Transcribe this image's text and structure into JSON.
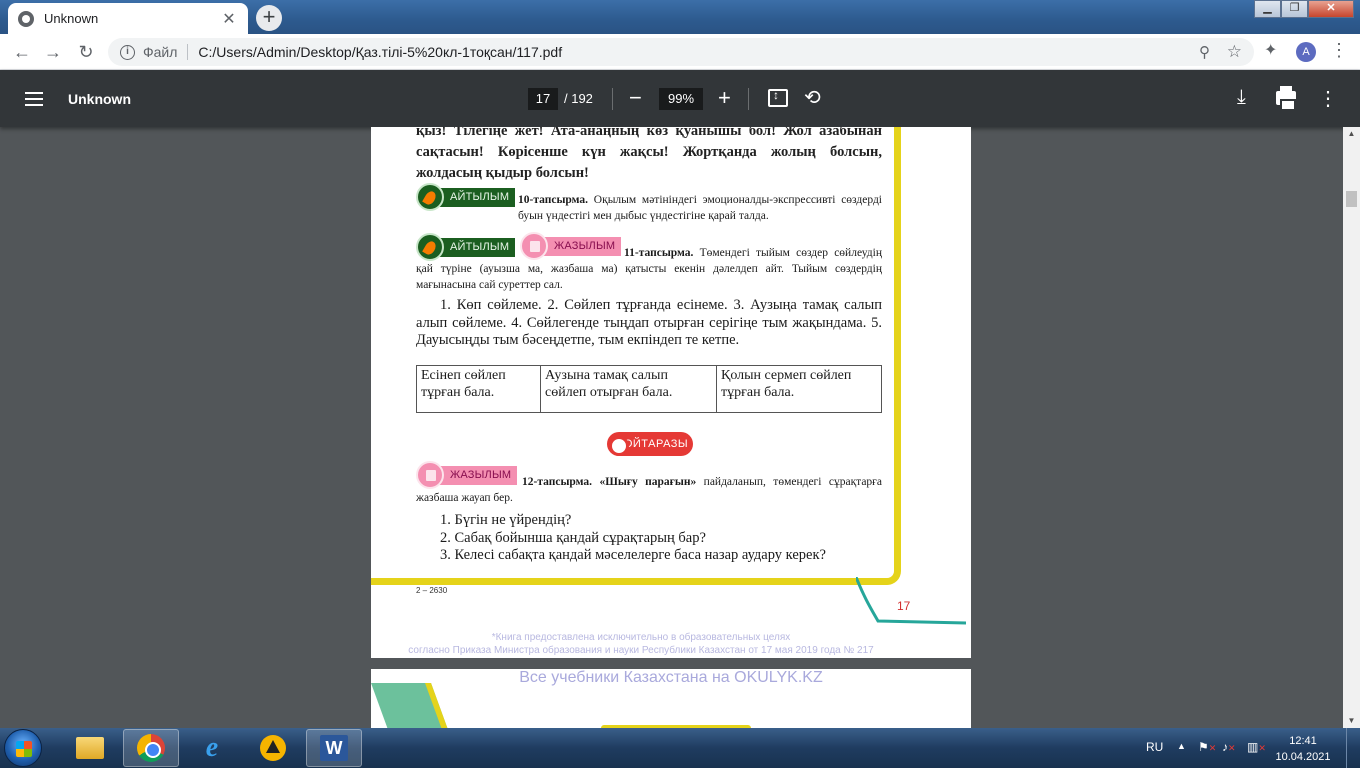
{
  "browser": {
    "tab_title": "Unknown",
    "tab_close": "✕",
    "new_tab": "+",
    "window_controls": {
      "minimize": "▁",
      "maximize": "❐",
      "close": "✕"
    },
    "address": {
      "scheme_label": "Файл",
      "url": "C:/Users/Admin/Desktop/Қаз.тілі-5%20кл-1тоқсан/117.pdf"
    },
    "nav": {
      "back": "←",
      "forward": "→",
      "reload": "↻",
      "zoom": "⚲",
      "star": "☆",
      "extensions": "✦",
      "menu": "⋮"
    },
    "profile_initial": "A"
  },
  "pdf_viewer": {
    "title": "Unknown",
    "current_page": "17",
    "total_pages": "/ 192",
    "zoom": "99%",
    "zoom_minus": "−",
    "zoom_plus": "+",
    "rotate": "⟲",
    "download": "⤓",
    "more": "⋮"
  },
  "page": {
    "intro": "қыз! Тілегіңе жет! Ата-анаңның көз қуанышы бол! Жол азабынан сақтасын! Көрісенше күн жақсы! Жортқанда жолың болсын, жолдасың қыдыр болсын!",
    "badge_speaking": "АЙТЫЛЫМ",
    "badge_writing": "ЖАЗЫЛЫМ",
    "task10_label": "10-тапсырма.",
    "task10_text": "Оқылым мәтініндегі эмоционалды-экспрессивті сөздерді буын үндестігі мен дыбыс үндестігіне қарай талда.",
    "task11_label": "11-тапсырма.",
    "task11_text": "Төмендегі тыйым сөздер сөйлеудің қай түріне (ауызша ма, жазбаша ма) қатысты екенін дәлелдеп айт. Тыйым сөздердің мағынасына сай суреттер сал.",
    "list11": "1. Көп сөйлеме. 2. Сөйлеп тұрғанда есінеме. 3. Аузыңа тамақ салып алып сөйлеме. 4. Сөйлегенде тыңдап отырған серігіңе тым жақындама. 5. Дауысыңды тым бәсеңдетпе, тым екпіндеп те кетпе.",
    "table": [
      "Есінеп сөйлеп тұрған бала.",
      "Аузына тамақ салып сөйлеп отырған бала.",
      "Қолын сермеп сөйлеп тұрған бала."
    ],
    "reflection": "ОЙТАРАЗЫ",
    "task12_label": "12-тапсырма.",
    "task12_quote": "«Шығу парағын»",
    "task12_text": "пайдаланып, төмендегі сұрақтарға жазбаша жауап бер.",
    "questions": [
      "1. Бүгін не үйрендің?",
      "2. Сабақ бойынша қандай сұрақтарың бар?",
      "3. Келесі сабақта қандай мәселелерге баса назар аудару керек?"
    ],
    "print_code": "2 – 2630",
    "page_number": "17",
    "disclaimer_1": "*Книга предоставлена исключительно в образовательных целях",
    "disclaimer_2": "согласно Приказа Министра образования и науки Республики Казахстан от 17 мая 2019 года № 217",
    "watermark": "Все учебники Казахстана на OKULYK.KZ"
  },
  "taskbar": {
    "lang": "RU",
    "tray_arrow": "▲",
    "time": "12:41",
    "date": "10.04.2021",
    "word_letter": "W",
    "ie_letter": "e"
  },
  "colors": {
    "accent_green": "#1b5e20",
    "accent_pink": "#f48fb1",
    "frame_yellow": "#e5d31a",
    "reflect_red": "#e53935"
  }
}
